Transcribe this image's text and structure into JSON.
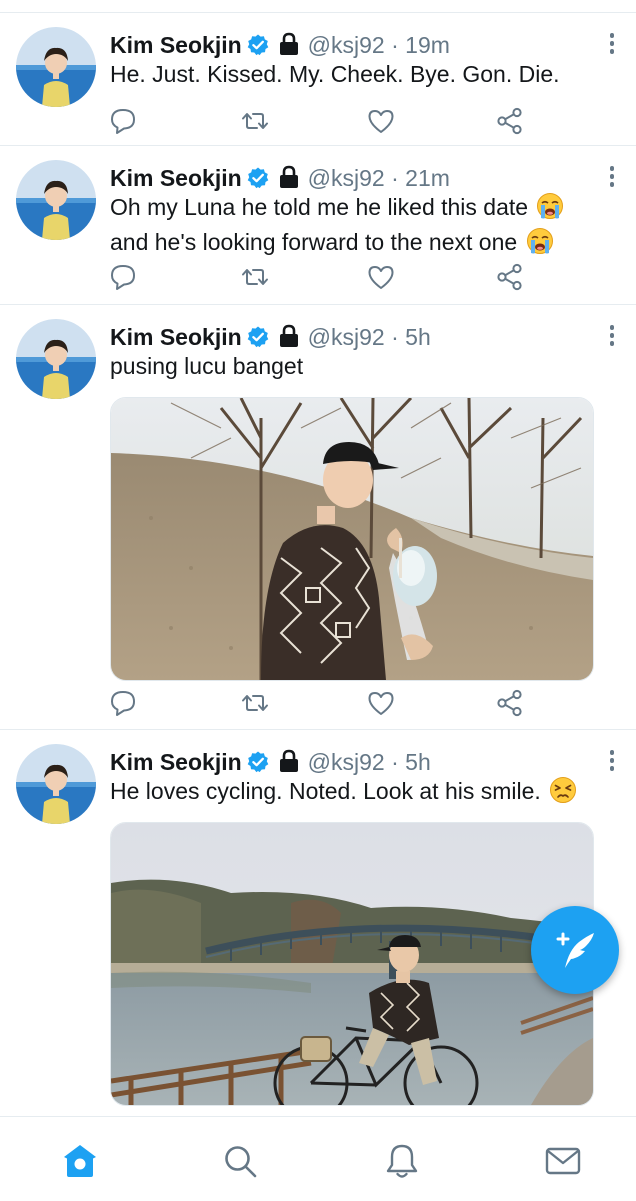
{
  "tweets": [
    {
      "author_name": "Kim Seokjin",
      "handle": "@ksj92",
      "separator": "·",
      "time": "19m",
      "text": "He. Just. Kissed. My. Cheek. Bye. Gon. Die.",
      "verified_icon": "verified-badge-icon",
      "lock_icon": "lock-icon"
    },
    {
      "author_name": "Kim Seokjin",
      "handle": "@ksj92",
      "separator": "·",
      "time": "21m",
      "text_line1": "Oh my Luna he told me he liked this date",
      "text_line2": "and he's looking forward to the next one",
      "emoji": "loudly-crying-face-emoji"
    },
    {
      "author_name": "Kim Seokjin",
      "handle": "@ksj92",
      "separator": "·",
      "time": "5h",
      "text": "pusing lucu banget",
      "media": "photo-man-in-cap-holding-cotton-candy-on-grassy-hill"
    },
    {
      "author_name": "Kim Seokjin",
      "handle": "@ksj92",
      "separator": "·",
      "time": "5h",
      "text": "He loves cycling. Noted. Look at his smile.",
      "emoji": "persevering-face-emoji",
      "media": "photo-man-on-bicycle-by-river-and-bridge"
    }
  ],
  "tweet_actions": [
    "reply-icon",
    "retweet-icon",
    "like-icon",
    "share-icon"
  ],
  "compose_button": "compose-tweet-icon",
  "bottom_nav": [
    "home-icon",
    "search-icon",
    "notifications-icon",
    "messages-icon"
  ],
  "colors": {
    "accent": "#1da1f2",
    "text_primary": "#14171a",
    "text_secondary": "#657786",
    "divider": "#e6ecf0"
  }
}
